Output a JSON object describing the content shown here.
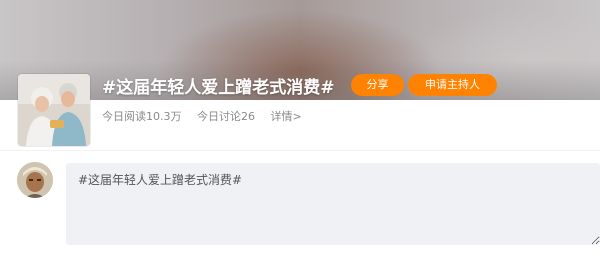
{
  "topic": {
    "title": "#这届年轻人爱上蹭老式消费#",
    "share_label": "分享",
    "host_label": "申请主持人",
    "stats": {
      "reads": "今日阅读10.3万",
      "discussions": "今日讨论26",
      "details": "详情>"
    },
    "avatar_icon": "elderly-couple-photo",
    "accent_color": "#ff8200"
  },
  "composer": {
    "user_avatar_icon": "user-avatar-photo",
    "text": "#这届年轻人爱上蹭老式消费#"
  }
}
